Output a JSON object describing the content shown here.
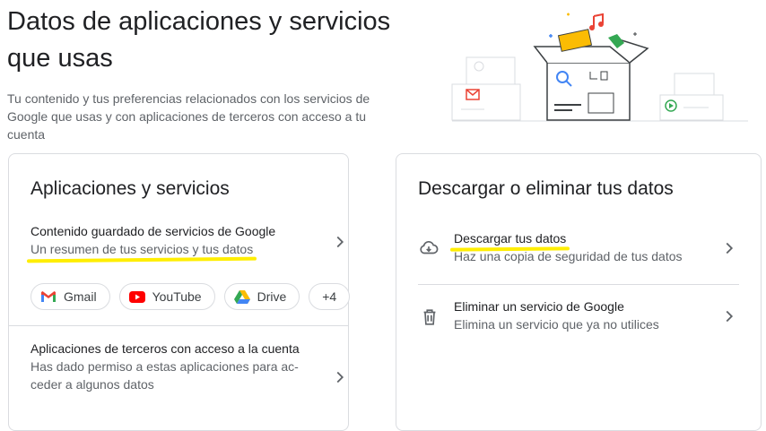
{
  "header": {
    "title": "Datos de aplicaciones y servicios que usas",
    "subtitle": "Tu contenido y tus preferencias relacionados con los servicios de Google que usas y con aplicaciones de terceros con acceso a tu cuenta"
  },
  "apps_card": {
    "title": "Aplicaciones y servicios",
    "saved_content": {
      "title": "Contenido guardado de servicios de Google",
      "subtitle": "Un resumen de tus servicios y tus datos"
    },
    "chips": [
      {
        "label": "Gmail",
        "icon": "gmail-icon"
      },
      {
        "label": "YouTube",
        "icon": "youtube-icon"
      },
      {
        "label": "Drive",
        "icon": "drive-icon"
      },
      {
        "label": "+4"
      }
    ],
    "third_party": {
      "title": "Aplicaciones de terceros con acceso a la cuenta",
      "subtitle": "Has dado permiso a estas aplicaciones para ac-ceder a algunos datos"
    }
  },
  "data_card": {
    "title": "Descargar o eliminar tus datos",
    "download": {
      "title": "Descargar tus datos",
      "subtitle": "Haz una copia de seguridad de tus datos",
      "icon": "cloud-download-icon"
    },
    "delete": {
      "title": "Eliminar un servicio de Google",
      "subtitle": "Elimina un servicio que ya no utilices",
      "icon": "trash-icon"
    }
  },
  "colors": {
    "highlight": "#ffee00",
    "border": "#dadce0",
    "text_secondary": "#5f6368"
  }
}
